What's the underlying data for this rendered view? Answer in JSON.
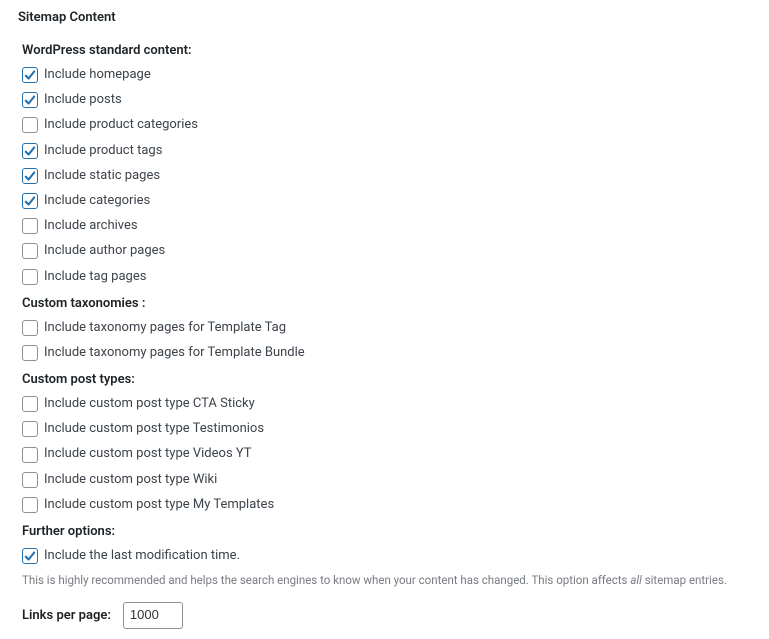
{
  "title": "Sitemap Content",
  "sections": {
    "standard": {
      "heading": "WordPress standard content:",
      "items": [
        {
          "label": "Include homepage",
          "checked": true
        },
        {
          "label": "Include posts",
          "checked": true
        },
        {
          "label": "Include product categories",
          "checked": false
        },
        {
          "label": "Include product tags",
          "checked": true
        },
        {
          "label": "Include static pages",
          "checked": true
        },
        {
          "label": "Include categories",
          "checked": true
        },
        {
          "label": "Include archives",
          "checked": false
        },
        {
          "label": "Include author pages",
          "checked": false
        },
        {
          "label": "Include tag pages",
          "checked": false
        }
      ]
    },
    "taxonomies": {
      "heading": "Custom taxonomies :",
      "items": [
        {
          "label": "Include taxonomy pages for Template Tag",
          "checked": false
        },
        {
          "label": "Include taxonomy pages for Template Bundle",
          "checked": false
        }
      ]
    },
    "post_types": {
      "heading": "Custom post types:",
      "items": [
        {
          "label": "Include custom post type CTA Sticky",
          "checked": false
        },
        {
          "label": "Include custom post type Testimonios",
          "checked": false
        },
        {
          "label": "Include custom post type Videos YT",
          "checked": false
        },
        {
          "label": "Include custom post type Wiki",
          "checked": false
        },
        {
          "label": "Include custom post type My Templates",
          "checked": false
        }
      ]
    },
    "further": {
      "heading": "Further options:",
      "items": [
        {
          "label": "Include the last modification time.",
          "checked": true
        }
      ],
      "help_prefix": "This is highly recommended and helps the search engines to know when your content has changed. This option affects ",
      "help_em": "all",
      "help_suffix": " sitemap entries."
    }
  },
  "links_per_page": {
    "label": "Links per page:",
    "value": "1000"
  }
}
